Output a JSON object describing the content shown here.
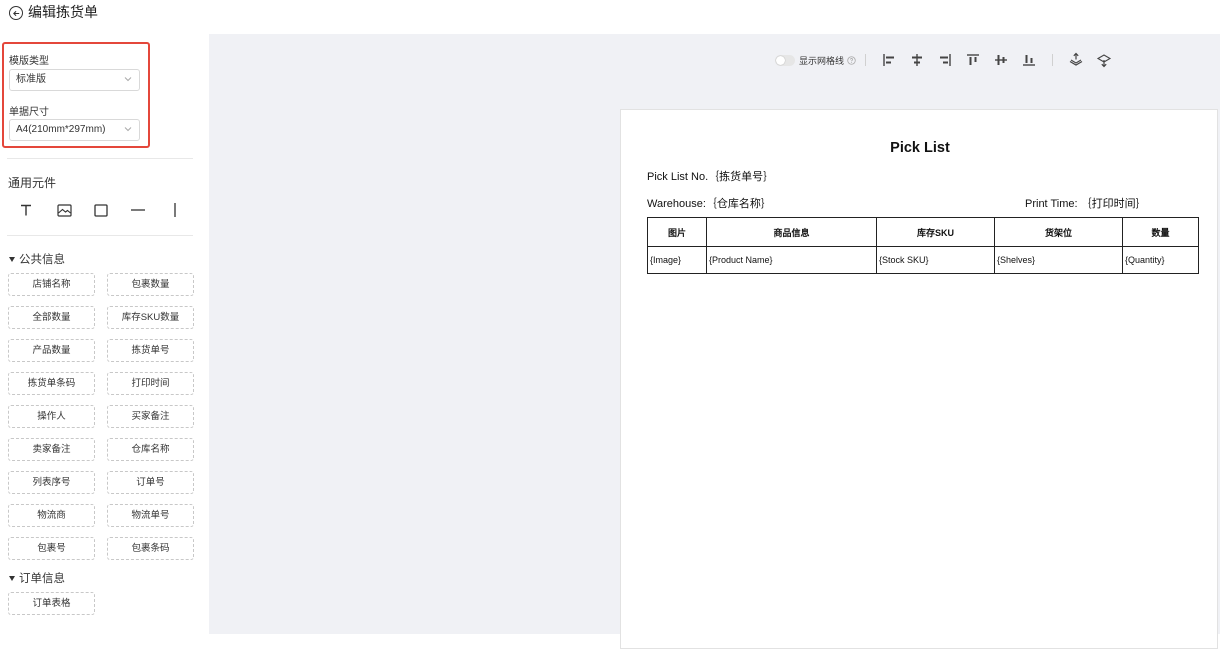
{
  "header": {
    "title": "编辑拣货单"
  },
  "template": {
    "type_label": "模版类型",
    "type_value": "标准版",
    "size_label": "单据尺寸",
    "size_value": "A4(210mm*297mm)"
  },
  "components": {
    "title": "通用元件",
    "tools": [
      "text-icon",
      "image-icon",
      "rectangle-icon",
      "horizontal-line-icon",
      "vertical-line-icon"
    ]
  },
  "public_info": {
    "title": "公共信息",
    "items": [
      "店铺名称",
      "包裹数量",
      "全部数量",
      "库存SKU数量",
      "产品数量",
      "拣货单号",
      "拣货单条码",
      "打印时间",
      "操作人",
      "买家备注",
      "卖家备注",
      "仓库名称",
      "列表序号",
      "订单号",
      "物流商",
      "物流单号",
      "包裹号",
      "包裹条码"
    ]
  },
  "order_info": {
    "title": "订单信息",
    "items": [
      "订单表格"
    ]
  },
  "toolbar": {
    "grid_label": "显示网格线",
    "grid_enabled": false,
    "buttons": [
      "align-left-icon",
      "align-center-horizontal-icon",
      "align-right-icon",
      "align-top-icon",
      "align-middle-vertical-icon",
      "align-bottom-icon",
      "bring-to-front-icon",
      "send-to-back-icon"
    ]
  },
  "document": {
    "title": "Pick List",
    "pick_no": "Pick List No.｛拣货单号｝",
    "warehouse": "Warehouse:｛仓库名称｝",
    "print_time": "Print Time: ｛打印时间｝",
    "table": {
      "headers": [
        "图片",
        "商品信息",
        "库存SKU",
        "货架位",
        "数量"
      ],
      "row": [
        "{Image}",
        "{Product Name}",
        "{Stock SKU}",
        "{Shelves}",
        "{Quantity}"
      ]
    }
  }
}
